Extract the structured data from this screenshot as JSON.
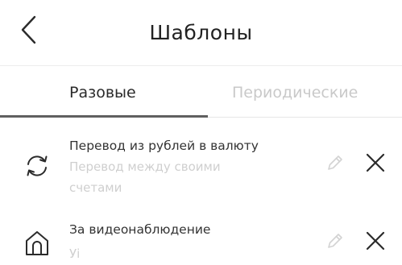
{
  "header": {
    "title": "Шаблоны",
    "back_icon": "chevron-left-icon"
  },
  "tabs": [
    {
      "label": "Разовые",
      "active": true
    },
    {
      "label": "Периодические",
      "active": false
    }
  ],
  "colors": {
    "text_primary": "#222222",
    "text_muted": "#cfcfcf",
    "tab_indicator": "#606060",
    "icon_dark": "#2b2b2b",
    "edit_icon": "#d3d3d3"
  },
  "templates": [
    {
      "icon": "exchange-arrows-icon",
      "title": "Перевод из рублей в валюту",
      "subtitle": "Перевод между своими счетами",
      "edit_icon": "pencil-icon",
      "delete_icon": "close-icon"
    },
    {
      "icon": "house-icon",
      "title": "За видеонаблюдение",
      "subtitle": "Уі",
      "edit_icon": "pencil-icon",
      "delete_icon": "close-icon"
    }
  ]
}
